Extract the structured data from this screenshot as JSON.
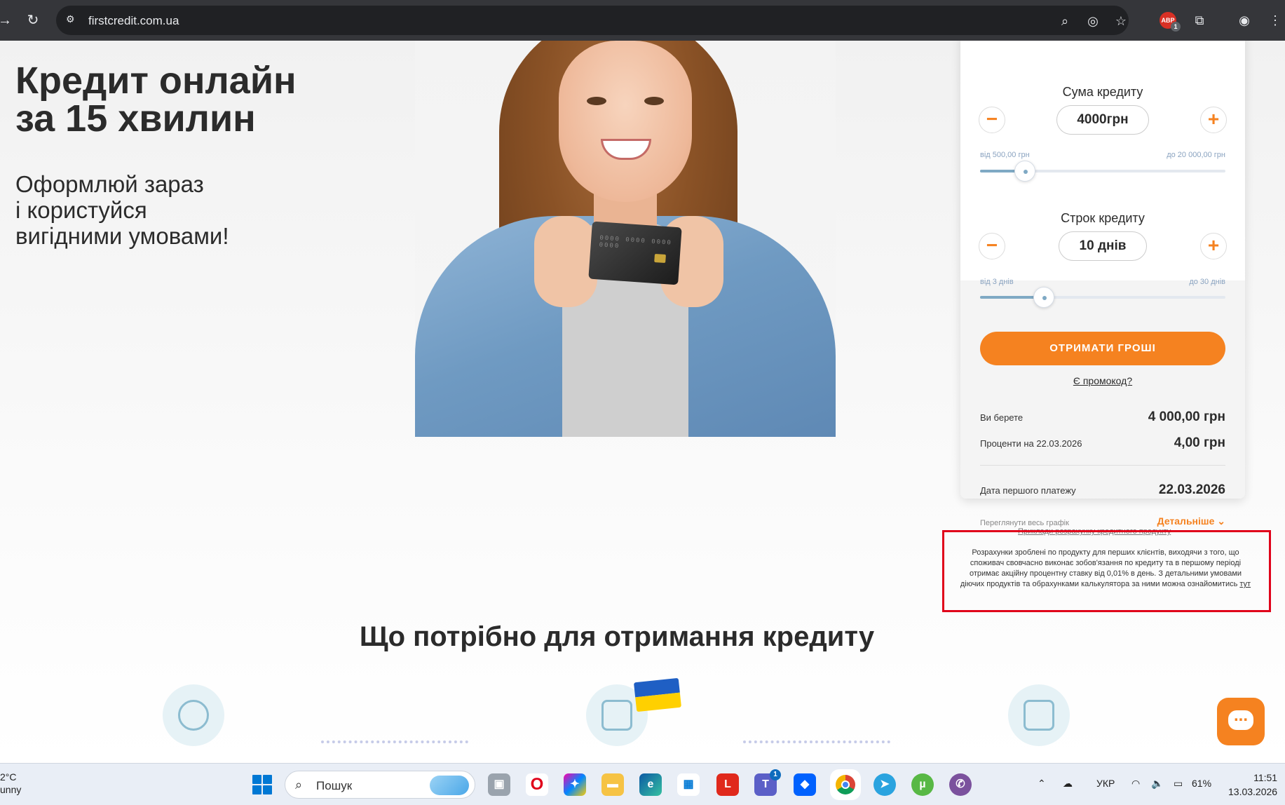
{
  "browser": {
    "url": "firstcredit.com.ua",
    "extension_badge_label": "ABP",
    "extension_badge_count": "1"
  },
  "hero": {
    "title_line1": "Кредит онлайн",
    "title_line2": "за 15 хвилин",
    "subtitle_line1": "Оформлюй зараз",
    "subtitle_line2": "і користуйся",
    "subtitle_line3": "вигідними умовами!",
    "card_digits": "0000 0000 0000 0000"
  },
  "calculator": {
    "amount": {
      "title": "Сума кредиту",
      "value": "4000грн",
      "min_label": "від 500,00 грн",
      "max_label": "до 20 000,00 грн",
      "slider_fraction": 0.1842
    },
    "term": {
      "title": "Строк кредиту",
      "value": "10 днів",
      "min_label": "від 3 днів",
      "max_label": "до 30 днів",
      "slider_fraction": 0.2593
    },
    "decrement_symbol": "−",
    "increment_symbol": "+",
    "cta_label": "ОТРИМАТИ ГРОШІ",
    "promo_label": "Є промокод?",
    "summary": [
      {
        "label": "Ви берете",
        "value": "4 000,00 грн"
      },
      {
        "label": "Проценти на 22.03.2026",
        "value": "4,00 грн"
      },
      {
        "label": "Дата першого платежу",
        "value": "22.03.2026"
      }
    ],
    "schedule_label": "Переглянути весь графік",
    "details_label": "Детальніше"
  },
  "calc_example_link": "Приклади розрахунку кредитного продукту",
  "note": {
    "text": "Розрахунки зроблені по продукту для перших клієнтів, виходячи з того, що споживач свовчасно виконає зобов'язання по кредиту та в першому періоді отримає акційну процентну ставку від 0,01% в день. З детальними умовами діючих продуктів та обрахунками калькулятора за ними можна ознайомитись",
    "link": "тут"
  },
  "section": {
    "title": "Що потрібно для отримання кредиту"
  },
  "colors": {
    "accent": "#f58220",
    "highlight_border": "#e0001a",
    "slider": "#7fa9c4"
  },
  "taskbar": {
    "weather_temp": "2°C",
    "weather_desc": "unny",
    "search_placeholder": "Пошук",
    "apps": [
      "file-explorer-multi",
      "opera",
      "copilot",
      "folder",
      "edge",
      "store",
      "l-app",
      "teams",
      "dropbox",
      "chrome",
      "telegram",
      "utorrent",
      "viber"
    ],
    "teams_badge": "1",
    "language": "УКР",
    "battery": "61%",
    "time": "11:51",
    "date": "13.03.2026"
  }
}
